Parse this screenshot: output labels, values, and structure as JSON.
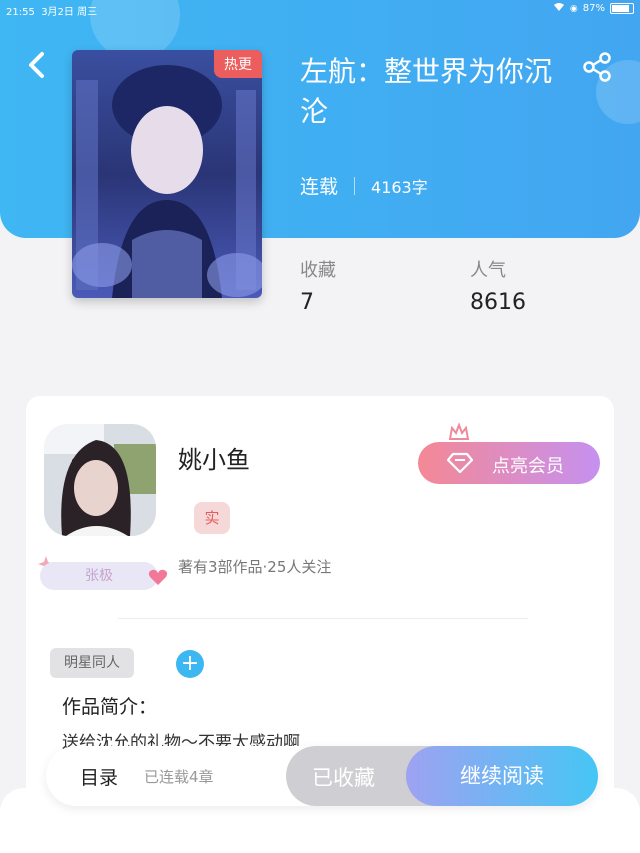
{
  "status_bar": {
    "time": "21:55",
    "date": "3月2日 周三",
    "battery": "87%",
    "battery_level": 0.87
  },
  "book": {
    "title": "左航：整世界为你沉沦",
    "status": "连载",
    "word_count": "4163字",
    "badge": "热更",
    "stats": [
      {
        "label": "收藏",
        "value": "7"
      },
      {
        "label": "人气",
        "value": "8616"
      }
    ]
  },
  "author": {
    "name": "姚小鱼",
    "real_badge": "实",
    "level": "张极",
    "meta": "著有3部作品·25人关注",
    "vip_button": "点亮会员"
  },
  "tags": [
    "明星同人"
  ],
  "intro": {
    "heading": "作品简介：",
    "text": "送给沈允的礼物～不要太感动啊"
  },
  "bottom_bar": {
    "toc_label": "目录",
    "toc_count": "已连载4章",
    "favorite_label": "已收藏",
    "read_label": "继续阅读"
  },
  "colors": {
    "header": "#42a6f1",
    "accent": "#3cb7f2",
    "hot": "#ec5e5e",
    "vip_start": "#f48895",
    "vip_end": "#c591f0"
  }
}
